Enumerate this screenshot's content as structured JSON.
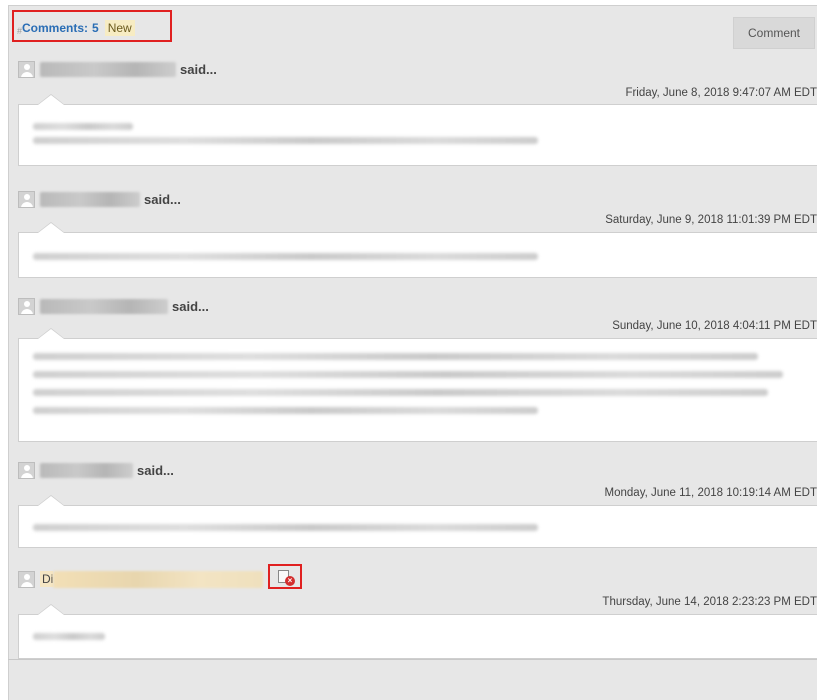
{
  "header": {
    "title": "Comments:",
    "count": "5",
    "new_badge": "New",
    "hash_mark": "#"
  },
  "comment_button": {
    "label": "Comment"
  },
  "comments": [
    {
      "said": "said...",
      "timestamp": "Friday, June 8, 2018 9:47:07 AM EDT"
    },
    {
      "said": "said...",
      "timestamp": "Saturday, June 9, 2018 11:01:39 PM EDT"
    },
    {
      "said": "said...",
      "timestamp": "Sunday, June 10, 2018 4:04:11 PM EDT"
    },
    {
      "said": "said...",
      "timestamp": "Monday, June 11, 2018 10:19:14 AM EDT"
    },
    {
      "author_prefix": "Di",
      "timestamp": "Thursday, June 14, 2018 2:23:23 PM EDT"
    }
  ],
  "icons": {
    "avatar": "user-avatar-icon",
    "delete": "delete-comment-icon"
  },
  "colors": {
    "header_text": "#2a6db5",
    "highlight_box": "#e02020",
    "new_badge_bg": "#f7ecc3",
    "panel_bg": "#e7e7e7"
  }
}
